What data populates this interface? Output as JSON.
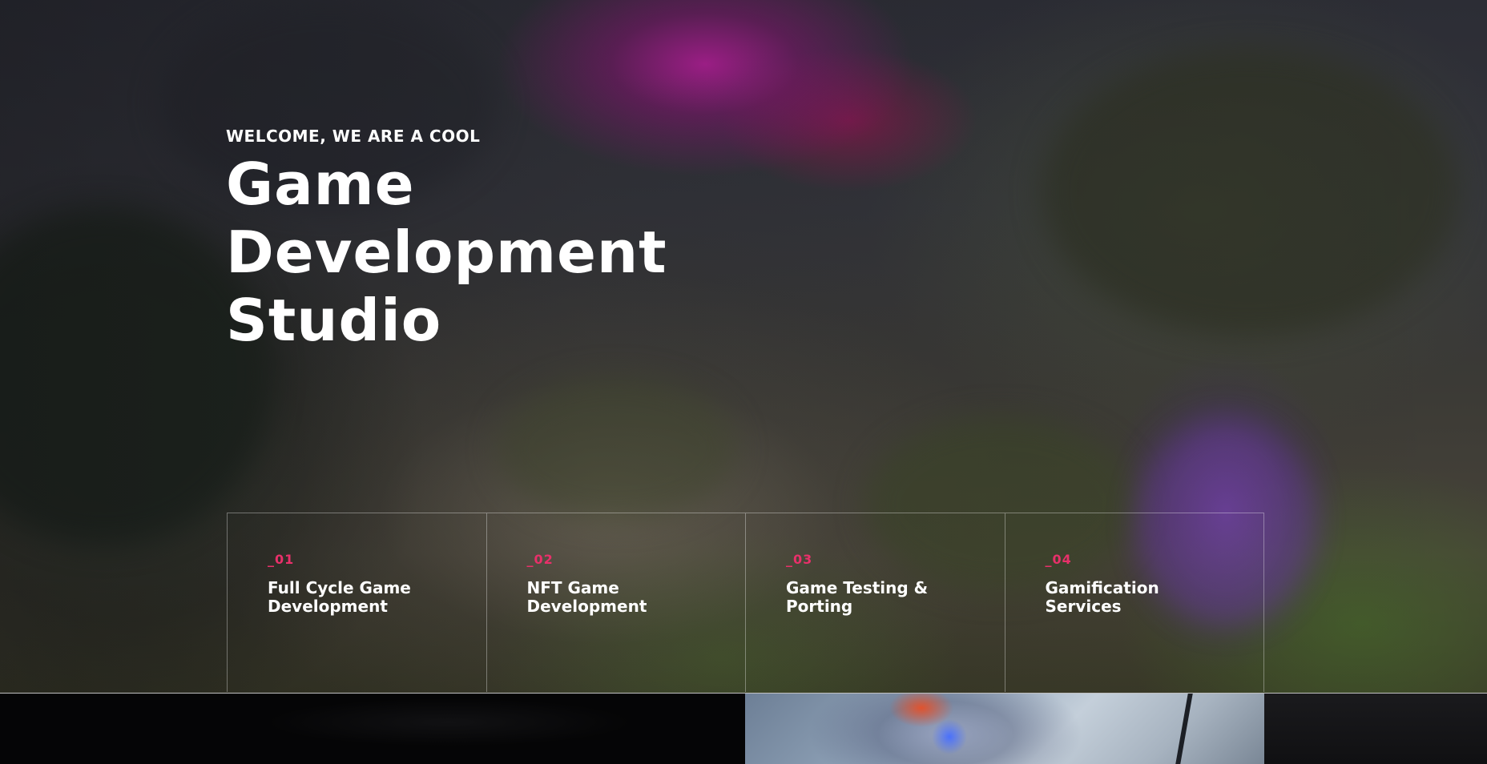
{
  "hero": {
    "eyebrow": "WELCOME, WE ARE A COOL",
    "headline_lines": [
      "Game",
      "Development",
      "Studio"
    ]
  },
  "services": [
    {
      "number": "_01",
      "title": "Full Cycle Game Development"
    },
    {
      "number": "_02",
      "title": "NFT Game Development"
    },
    {
      "number": "_03",
      "title": "Game Testing & Porting"
    },
    {
      "number": "_04",
      "title": "Gamification Services"
    }
  ],
  "colors": {
    "accent": "#e8306a",
    "text": "#ffffff",
    "bottom_bar": "#050506"
  }
}
